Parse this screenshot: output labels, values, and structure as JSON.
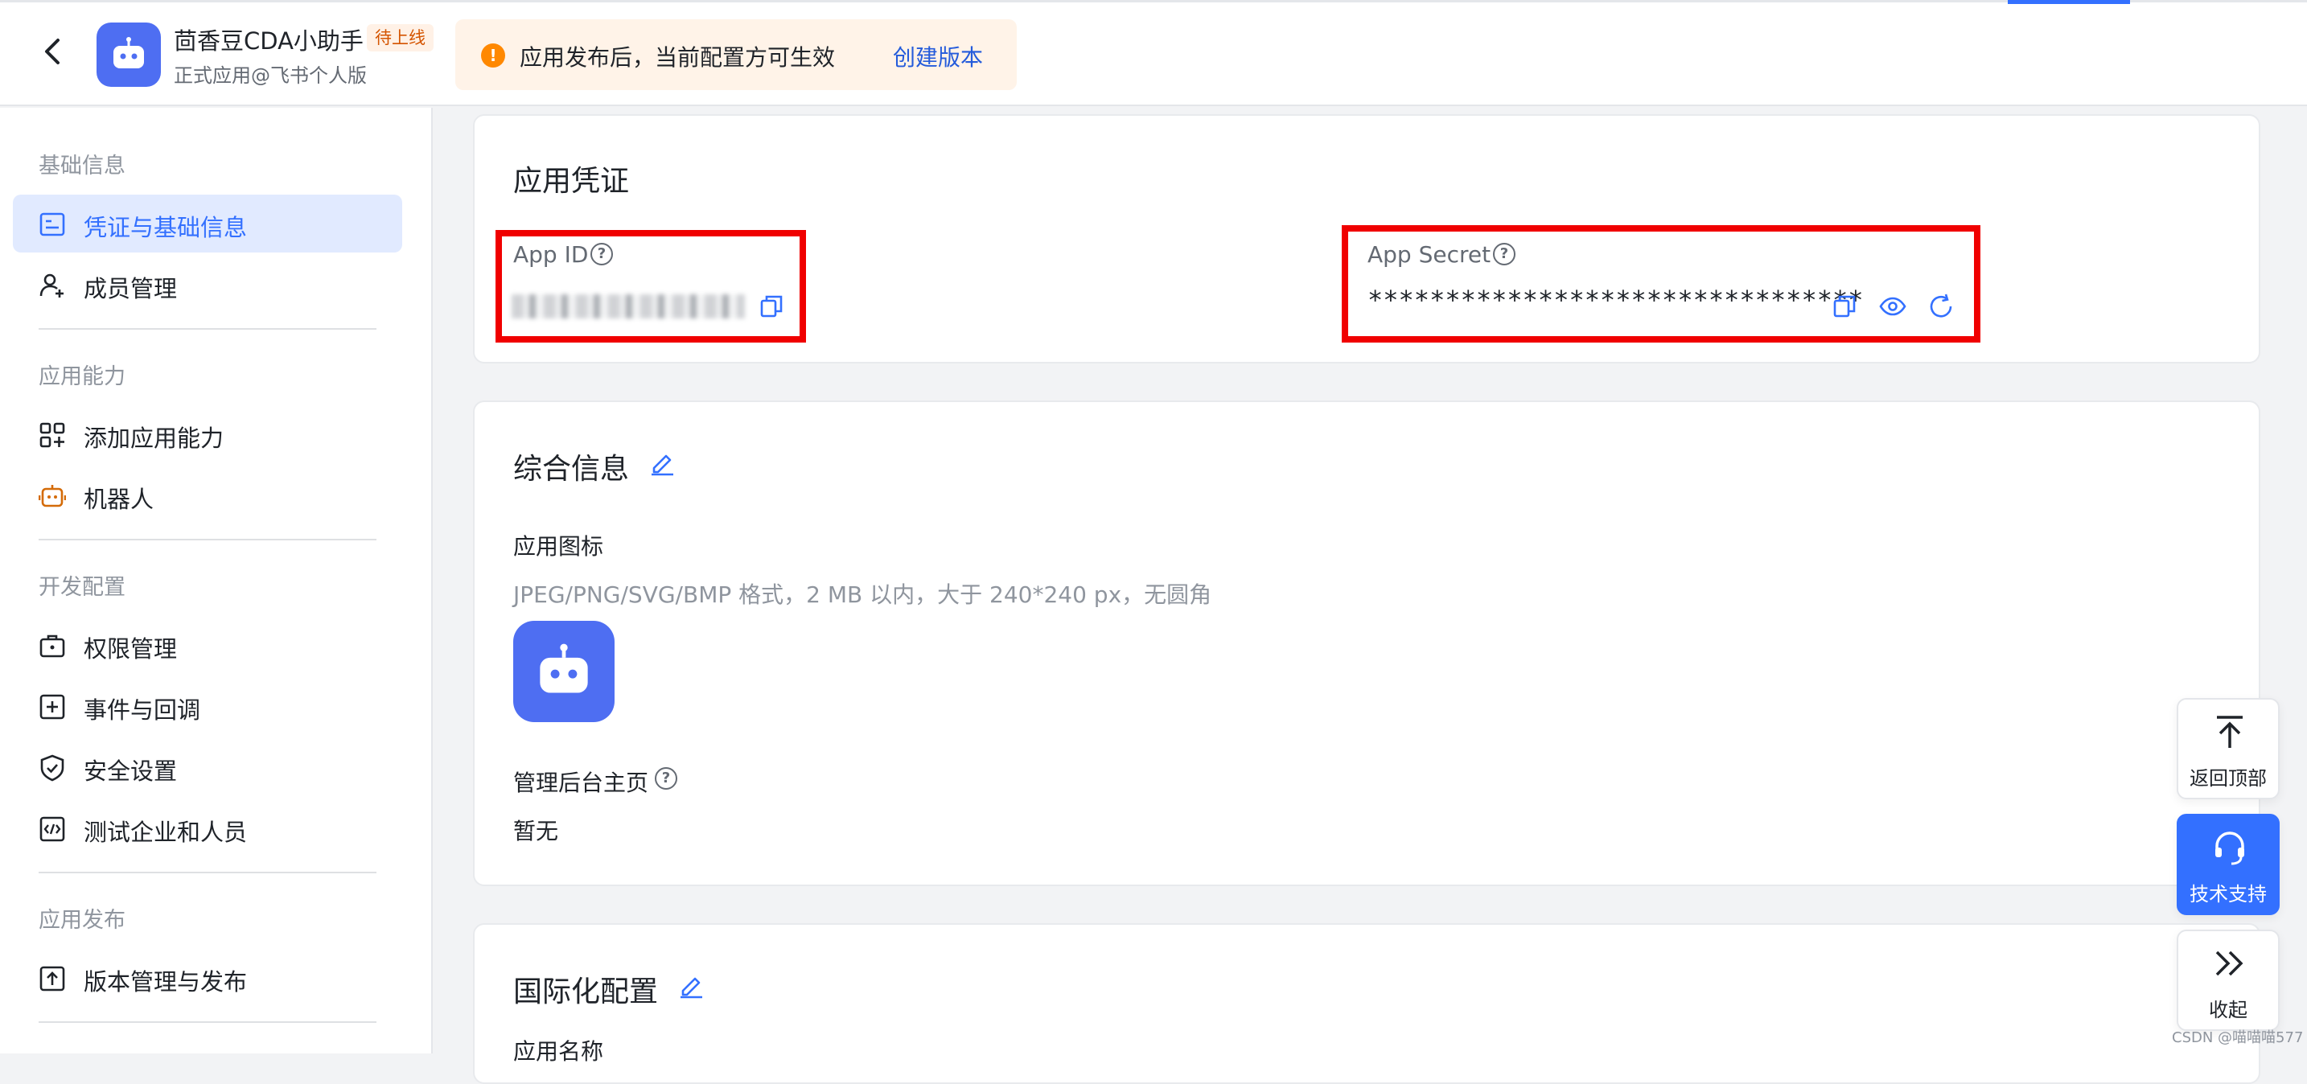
{
  "header": {
    "app_name": "茴香豆CDA小助手",
    "app_badge": "待上线",
    "app_subtitle": "正式应用@飞书个人版",
    "notice_text": "应用发布后，当前配置方可生效",
    "notice_link": "创建版本",
    "back_icon": "chevron-left-icon",
    "logo_icon": "robot-icon"
  },
  "sidebar": {
    "groups": [
      {
        "title": "基础信息",
        "items": [
          {
            "label": "凭证与基础信息",
            "icon": "credential-icon",
            "active": true
          },
          {
            "label": "成员管理",
            "icon": "user-add-icon",
            "active": false
          }
        ]
      },
      {
        "title": "应用能力",
        "items": [
          {
            "label": "添加应用能力",
            "icon": "grid-add-icon",
            "active": false
          },
          {
            "label": "机器人",
            "icon": "robot-icon",
            "active": false
          }
        ]
      },
      {
        "title": "开发配置",
        "items": [
          {
            "label": "权限管理",
            "icon": "briefcase-icon",
            "active": false
          },
          {
            "label": "事件与回调",
            "icon": "event-icon",
            "active": false
          },
          {
            "label": "安全设置",
            "icon": "shield-icon",
            "active": false
          },
          {
            "label": "测试企业和人员",
            "icon": "code-icon",
            "active": false
          }
        ]
      },
      {
        "title": "应用发布",
        "items": [
          {
            "label": "版本管理与发布",
            "icon": "upload-icon",
            "active": false
          }
        ]
      }
    ]
  },
  "credentials": {
    "title": "应用凭证",
    "app_id_label": "App ID",
    "app_secret_label": "App Secret",
    "app_secret_value": "********************************"
  },
  "general": {
    "title": "综合信息",
    "icon_label": "应用图标",
    "icon_hint": "JPEG/PNG/SVG/BMP 格式，2 MB 以内，大于 240*240 px，无圆角",
    "admin_label": "管理后台主页",
    "admin_value": "暂无"
  },
  "i18n": {
    "title": "国际化配置",
    "name_label": "应用名称"
  },
  "floating": {
    "top_label": "返回顶部",
    "support_label": "技术支持",
    "collapse_label": "收起"
  },
  "watermark": "CSDN @喵喵喵577",
  "colors": {
    "accent": "#3370ff",
    "link": "#245bdb",
    "warning": "#ff8800",
    "highlight_box": "#f00000"
  }
}
